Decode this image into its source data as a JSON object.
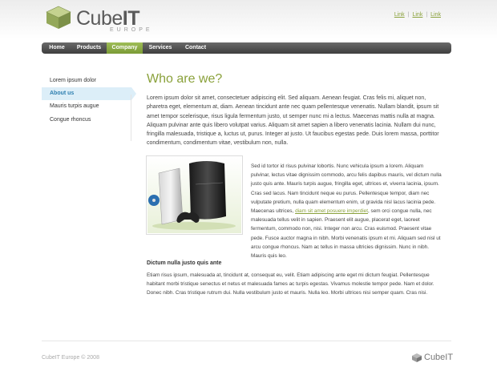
{
  "brand": {
    "name_part1": "Cube",
    "name_part2": "IT",
    "subtitle": "EUROPE",
    "accent": "#8aa13b",
    "cube_color": "#a6b86a"
  },
  "top_links": [
    "Link",
    "Link",
    "Link"
  ],
  "nav": {
    "items": [
      {
        "label": "Home",
        "active": false
      },
      {
        "label": "Products",
        "active": false
      },
      {
        "label": "Company",
        "active": true
      },
      {
        "label": "Services",
        "active": false
      },
      {
        "label": "Contact",
        "active": false
      }
    ]
  },
  "sidebar": {
    "items": [
      {
        "label": "Lorem ipsum dolor",
        "active": false
      },
      {
        "label": "About us",
        "active": true
      },
      {
        "label": "Mauris turpis augue",
        "active": false
      },
      {
        "label": "Congue rhoncus",
        "active": false
      }
    ]
  },
  "main": {
    "title": "Who are we?",
    "intro": "Lorem ipsum dolor sit amet, consectetuer adipiscing elit. Sed aliquam. Aenean feugiat. Cras felis mi, aliquet non, pharetra eget, elementum at, diam. Aenean tincidunt ante nec quam pellentesque venenatis. Nullam blandit, ipsum sit amet tempor scelerisque, risus ligula fermentum justo, ut semper nunc mi a lectus. Maecenas mattis nulla at magna. Aliquam pulvinar ante quis libero volutpat varius. Aliquam sit amet sapien a libero venenatis lacinia. Nullam dui nunc, fringilla malesuada, tristique a, luctus ut, purus. Integer at justo. Ut faucibus egestas pede. Duis lorem massa, porttitor condimentum, condimentum vitae, vestibulum non, nulla.",
    "side_text_1": "Sed id tortor id risus pulvinar lobortis. Nunc vehicula ipsum a lorem. Aliquam pulvinar, lectus vitae dignissim commodo, arcu felis dapibus mauris, vel dictum nulla justo quis ante. Mauris turpis augue, fringilla eget, ultrices et, viverra lacinia, ipsum. Cras sed lacus. Nam tincidunt neque eu purus. Pellentesque tempor, diam nec vulputate pretium, nulla quam elementum enim, ut gravida nisl lacus lacinia pede. Maecenas ultrices,",
    "side_link": "diam sit amet posuere imperdiet",
    "side_text_2": ", sem orci congue nulla, nec malesuada tellus velit in sapien. Praesent elit augue, placerat eget, laoreet fermentum, commodo non, nisi. Integer non arcu. Cras euismod. Praesent vitae pede. Fusce auctor magna in nibh. Morbi venenatis ipsum et mi. Aliquam sed nisl ut arcu congue rhoncus. Nam ac tellus in massa ultricies dignissim. Nunc in nibh. Mauris quis leo.",
    "sub_heading": "Dictum nulla justo quis ante",
    "bottom_para": "Etiam risus ipsum, malesuada at, tincidunt at, consequat eu, velit. Etiam adipiscing ante eget mi dictum feugiat. Pellentesque habitant morbi tristique senectus et netus et malesuada fames ac turpis egestas. Vivamus molestie tempor pede. Nam et dolor. Donec nibh. Cras tristique rutrum dui. Nulla vestibulum justo et mauris. Nulla leo. Morbi ultrices nisi semper quam. Cras nisi."
  },
  "footer": {
    "copyright": "CubeIT Europe © 2008",
    "logo_text": "CubeIT"
  }
}
